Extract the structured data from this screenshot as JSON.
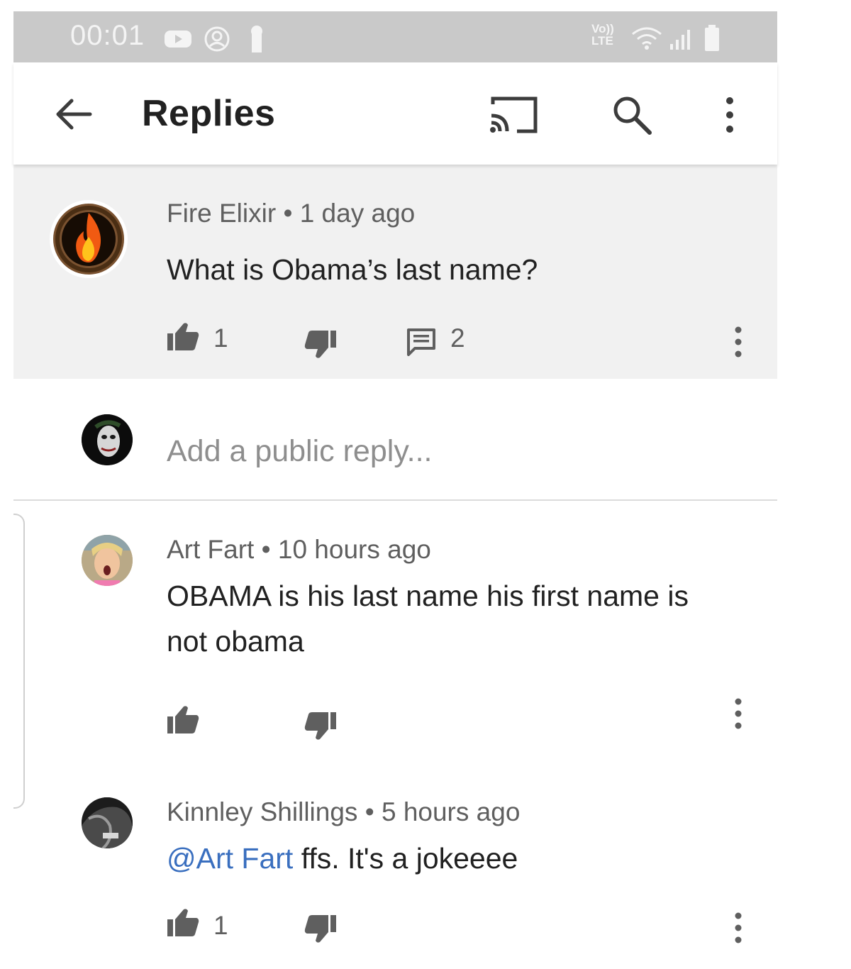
{
  "status_bar": {
    "time": "00:01",
    "network": "Vo))\nLTE"
  },
  "app_bar": {
    "title": "Replies"
  },
  "parent_comment": {
    "author": "Fire Elixir",
    "age": "1 day ago",
    "text": "What is Obama’s last name?",
    "likes": "1",
    "reply_count": "2"
  },
  "reply_input": {
    "placeholder": "Add a public reply..."
  },
  "replies": [
    {
      "author": "Art Fart",
      "age": "10 hours ago",
      "text": "OBAMA is his last name his first name is not obama",
      "likes": ""
    },
    {
      "author": "Kinnley Shillings",
      "age": "5 hours ago",
      "mention": "@Art Fart",
      "text": " ffs. It's a jokeeee",
      "likes": "1"
    }
  ],
  "separator": "•",
  "colors": {
    "status_bar": "#c9c9c9",
    "parent_bg": "#f1f1f1",
    "mention": "#3a6fbf",
    "meta": "#5f5f5f"
  }
}
